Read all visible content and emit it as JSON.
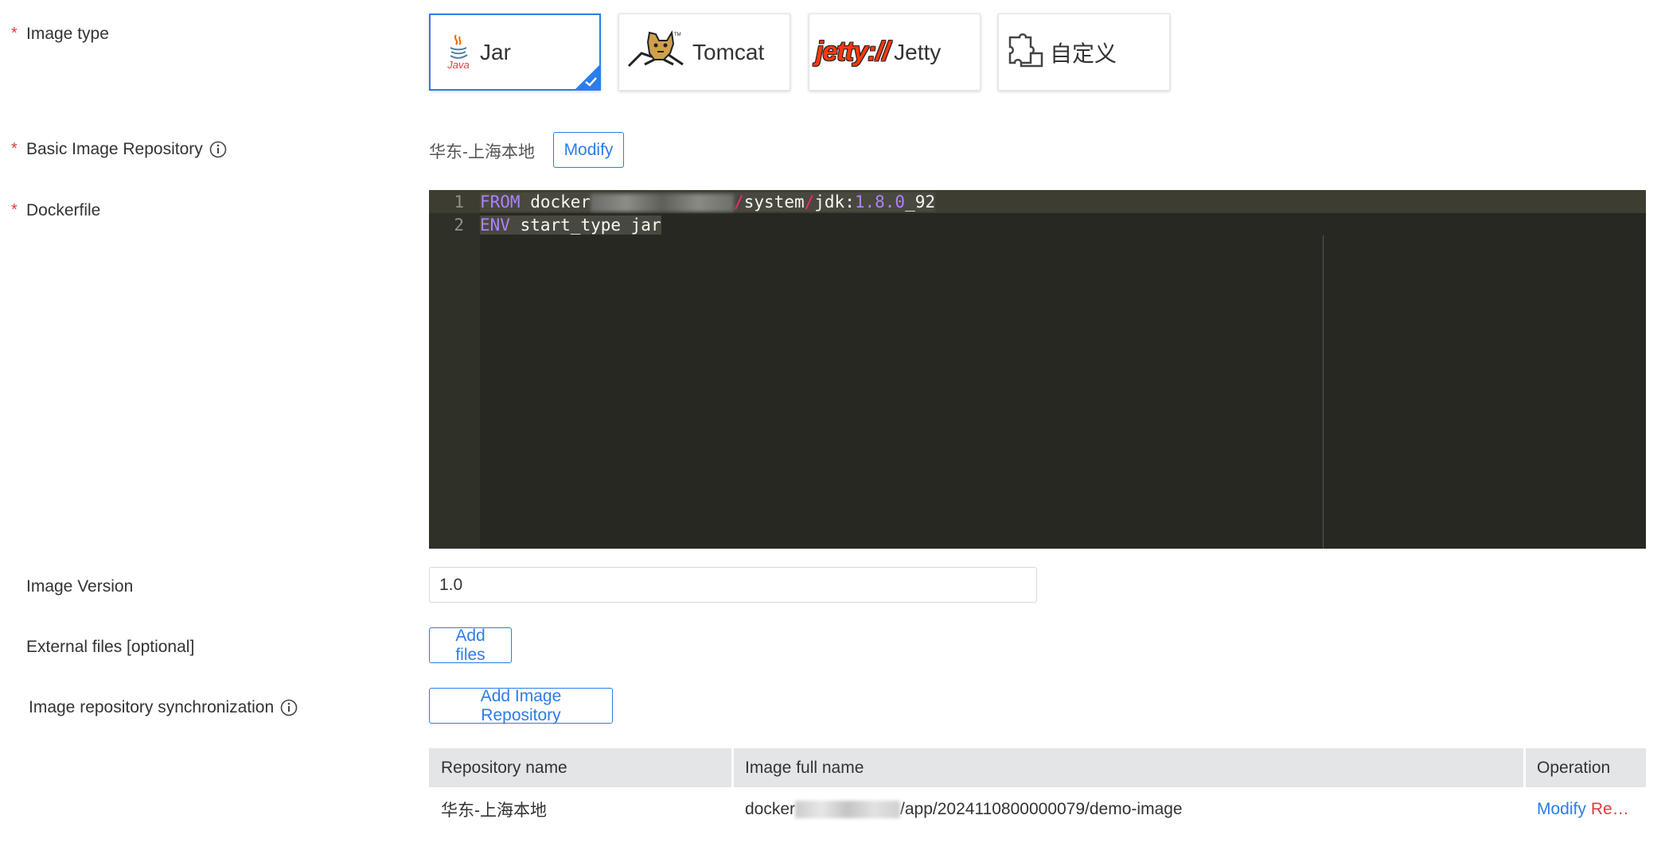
{
  "form": {
    "required_mark": "*",
    "image_type": {
      "label": "Image type",
      "options": [
        {
          "label": "Jar",
          "logo_text": "Java",
          "icon": "java-icon",
          "selected": true
        },
        {
          "label": "Tomcat",
          "icon": "tomcat-icon",
          "selected": false
        },
        {
          "label": "Jetty",
          "logo_text": "jetty://",
          "icon": "jetty-icon",
          "selected": false
        },
        {
          "label": "自定义",
          "icon": "puzzle-icon",
          "selected": false
        }
      ]
    },
    "basic_repo": {
      "label": "Basic Image Repository",
      "value": "华东-上海本地",
      "modify_label": "Modify"
    },
    "dockerfile": {
      "label": "Dockerfile",
      "lines": [
        {
          "number": "1",
          "keyword": "FROM",
          "text_a": " docker",
          "text_b": "/",
          "text_c": "system",
          "text_d": "/",
          "text_e": "jdk:",
          "text_f": "1.8.0",
          "text_g": "_92"
        },
        {
          "number": "2",
          "keyword": "ENV",
          "text_a": " start_type jar"
        }
      ]
    },
    "image_version": {
      "label": "Image Version",
      "value": "1.0"
    },
    "external_files": {
      "label": "External files [optional]",
      "button_label": "Add files"
    },
    "repo_sync": {
      "label": "Image repository synchronization",
      "button_label": "Add Image Repository",
      "table": {
        "columns": [
          "Repository name",
          "Image full name",
          "Operation"
        ],
        "rows": [
          {
            "repo_name": "华东-上海本地",
            "full_name_prefix": "docker",
            "full_name_suffix": "/app/2024110800000079/demo-image",
            "op_modify": "Modify",
            "op_remove": "Re…"
          }
        ]
      }
    }
  },
  "colors": {
    "accent": "#2b7de9",
    "required": "#e0393e",
    "editor_bg": "#272822"
  }
}
